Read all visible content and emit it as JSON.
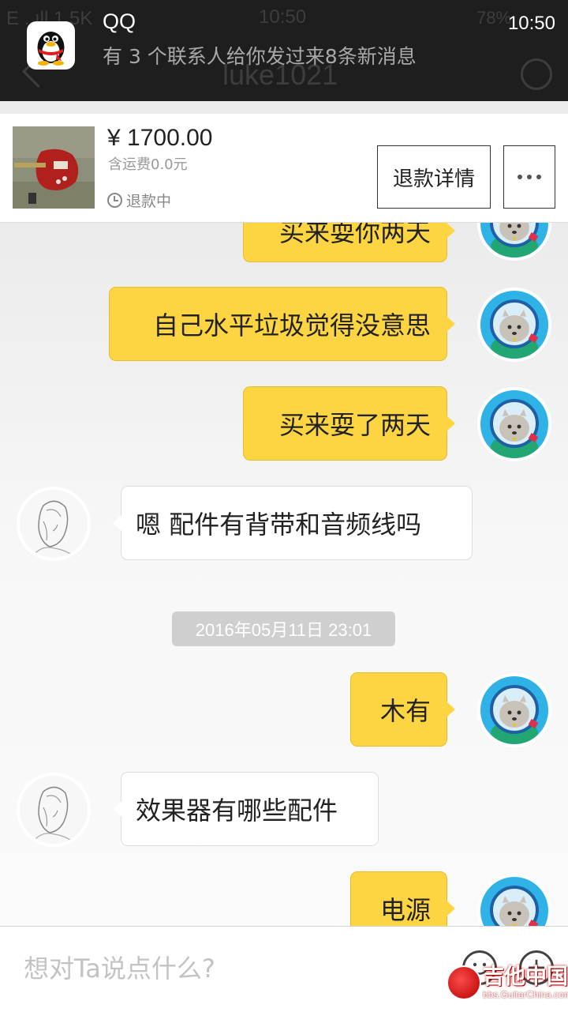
{
  "status_bar": {
    "carrier": "E ..ıll 1.5K",
    "time": "10:50",
    "battery": "78%"
  },
  "notification": {
    "app_name": "QQ",
    "time": "10:50",
    "message": "有 3 个联系人给你发过来8条新消息"
  },
  "header": {
    "title": "luke1021"
  },
  "product": {
    "price": "¥ 1700.00",
    "shipping": "含运费0.0元",
    "status": "退款中",
    "refund_button": "退款详情",
    "more_button": "..."
  },
  "messages": [
    {
      "side": "me",
      "text": "买来耍你两天"
    },
    {
      "side": "me",
      "text": "自己水平垃圾觉得没意思"
    },
    {
      "side": "me",
      "text": "买来耍了两天"
    },
    {
      "side": "them",
      "text": "嗯  配件有背带和音频线吗"
    },
    {
      "side": "me",
      "text": "木有"
    },
    {
      "side": "them",
      "text": "效果器有哪些配件"
    },
    {
      "side": "me",
      "text": "电源"
    }
  ],
  "timestamp": "2016年05月11日 23:01",
  "input": {
    "placeholder": "想对Ta说点什么?"
  },
  "watermark": {
    "title": "吉他中国",
    "url": "bbs.GuitarChina.com"
  },
  "icons": {
    "notif_app": "qq-penguin-icon",
    "clock": "clock-icon",
    "emoji": "smiley-icon",
    "plus": "plus-icon",
    "back": "back-arrow-icon",
    "profile": "profile-icon"
  },
  "colors": {
    "my_bubble": "#fdd543",
    "their_bubble": "#ffffff",
    "topbar": "#1e1e1e"
  }
}
